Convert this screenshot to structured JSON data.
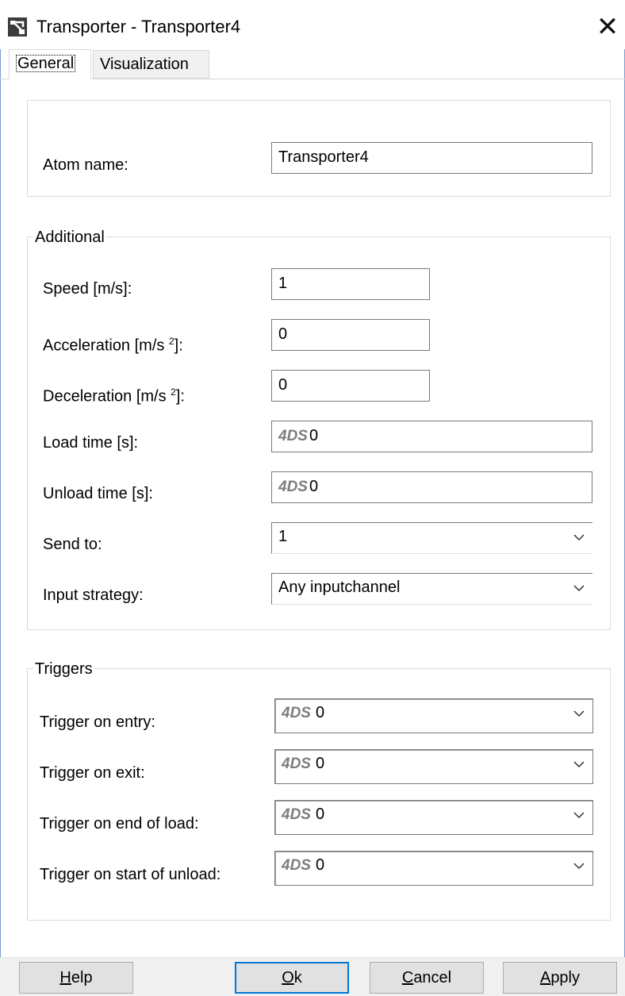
{
  "window": {
    "title": "Transporter - Transporter4",
    "close_icon": "close-icon",
    "app_icon": "transporter-app-icon"
  },
  "tabs": [
    {
      "label": "General",
      "selected": true
    },
    {
      "label": "Visualization",
      "selected": false
    }
  ],
  "general": {
    "atom_name_label": "Atom name:",
    "atom_name_value": "Transporter4"
  },
  "additional": {
    "title": "Additional",
    "speed_label": "Speed [m/s]:",
    "speed_value": "1",
    "accel_label_pre": "Acceleration [m/s ",
    "accel_label_sup": "2",
    "accel_label_post": "]:",
    "accel_value": "0",
    "decel_label_pre": "Deceleration [m/s ",
    "decel_label_sup": "2",
    "decel_label_post": "]:",
    "decel_value": "0",
    "load_label": "Load time [s]:",
    "load_prefix": "4DS",
    "load_value": "0",
    "unload_label": "Unload time [s]:",
    "unload_prefix": "4DS",
    "unload_value": "0",
    "send_to_label": "Send to:",
    "send_to_value": "1",
    "input_strategy_label": "Input strategy:",
    "input_strategy_value": "Any inputchannel"
  },
  "triggers": {
    "title": "Triggers",
    "items": [
      {
        "label": "Trigger on entry:",
        "prefix": "4DS",
        "value": "0"
      },
      {
        "label": "Trigger on exit:",
        "prefix": "4DS",
        "value": "0"
      },
      {
        "label": "Trigger on end of load:",
        "prefix": "4DS",
        "value": "0"
      },
      {
        "label": "Trigger on start of unload:",
        "prefix": "4DS",
        "value": "0"
      }
    ]
  },
  "buttons": {
    "help_mn": "H",
    "help_rest": "elp",
    "ok_mn": "O",
    "ok_rest": "k",
    "cancel_mn": "C",
    "cancel_rest": "ancel",
    "apply_mn": "A",
    "apply_rest": "pply"
  },
  "colors": {
    "accent": "#0078d7",
    "frame": "#7a9bd0",
    "button_face": "#e1e1e1",
    "fds_text": "#7d7d7d"
  }
}
